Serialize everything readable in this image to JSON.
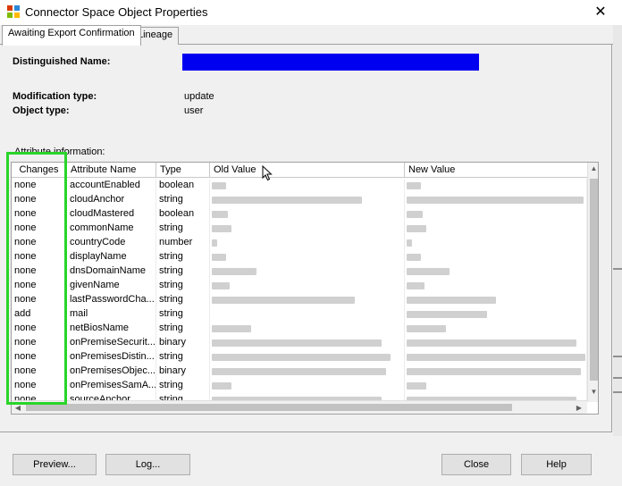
{
  "window": {
    "title": "Connector Space Object Properties",
    "close_glyph": "✕"
  },
  "tabs": [
    {
      "label": "Awaiting Export Confirmation",
      "active": true
    },
    {
      "label": "Lineage",
      "active": false
    }
  ],
  "properties": {
    "dn_label": "Distinguished Name:",
    "modification_label": "Modification type:",
    "modification_value": "update",
    "object_type_label": "Object type:",
    "object_type_value": "user"
  },
  "attributes": {
    "caption": "Attribute information:",
    "columns": [
      "Changes",
      "Attribute Name",
      "Type",
      "Old Value",
      "New Value"
    ],
    "rows": [
      {
        "change": "none",
        "name": "accountEnabled",
        "type": "boolean"
      },
      {
        "change": "none",
        "name": "cloudAnchor",
        "type": "string"
      },
      {
        "change": "none",
        "name": "cloudMastered",
        "type": "boolean"
      },
      {
        "change": "none",
        "name": "commonName",
        "type": "string"
      },
      {
        "change": "none",
        "name": "countryCode",
        "type": "number"
      },
      {
        "change": "none",
        "name": "displayName",
        "type": "string"
      },
      {
        "change": "none",
        "name": "dnsDomainName",
        "type": "string"
      },
      {
        "change": "none",
        "name": "givenName",
        "type": "string"
      },
      {
        "change": "none",
        "name": "lastPasswordCha...",
        "type": "string"
      },
      {
        "change": "add",
        "name": "mail",
        "type": "string"
      },
      {
        "change": "none",
        "name": "netBiosName",
        "type": "string"
      },
      {
        "change": "none",
        "name": "onPremiseSecurit...",
        "type": "binary"
      },
      {
        "change": "none",
        "name": "onPremisesDistin...",
        "type": "string"
      },
      {
        "change": "none",
        "name": "onPremisesObjec...",
        "type": "binary"
      },
      {
        "change": "none",
        "name": "onPremisesSamA...",
        "type": "string"
      },
      {
        "change": "none",
        "name": "sourceAnchor",
        "type": "string"
      }
    ]
  },
  "buttons": {
    "preview": "Preview...",
    "log": "Log...",
    "close": "Close",
    "help": "Help"
  },
  "colors": {
    "redaction": "#0000f0",
    "highlight": "#2ad52a"
  }
}
